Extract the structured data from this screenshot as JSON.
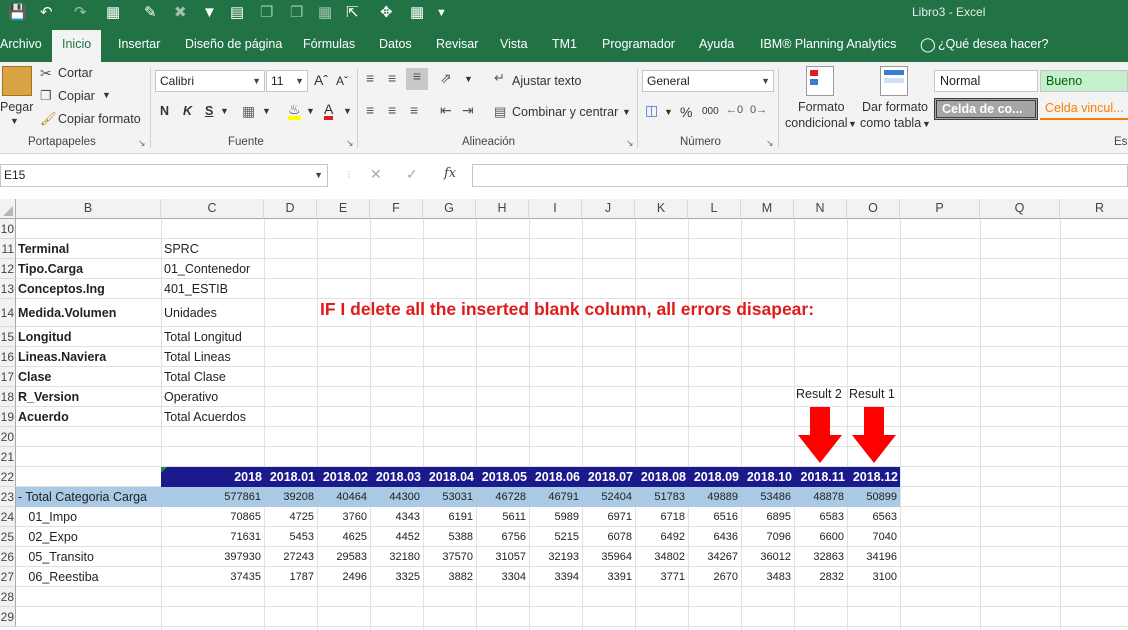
{
  "window": {
    "title": "Libro3  -  Excel"
  },
  "tabs": [
    "Archivo",
    "Inicio",
    "Insertar",
    "Diseño de página",
    "Fórmulas",
    "Datos",
    "Revisar",
    "Vista",
    "TM1",
    "Programador",
    "Ayuda",
    "IBM® Planning Analytics",
    "¿Qué desea hacer?"
  ],
  "ribbon": {
    "paste": "Pegar",
    "cut": "Cortar",
    "copy": "Copiar",
    "format_painter": "Copiar formato",
    "clipboard": "Portapapeles",
    "font_name": "Calibri",
    "font_size": "11",
    "bold": "N",
    "italic": "K",
    "underline": "S",
    "font": "Fuente",
    "wrap": "Ajustar texto",
    "merge": "Combinar y centrar",
    "alignment": "Alineación",
    "number_format": "General",
    "number": "Número",
    "percent": "%",
    "thousands": "000",
    "cond_format_1": "Formato",
    "cond_format_2": "condicional",
    "table_format_1": "Dar formato",
    "table_format_2": "como tabla",
    "style_normal": "Normal",
    "style_good": "Bueno",
    "style_check": "Celda de co...",
    "style_linked": "Celda vincul...",
    "styles": "Es"
  },
  "formula_bar": {
    "name_box": "E15",
    "fx": "fx",
    "formula": ""
  },
  "columns": [
    "B",
    "C",
    "D",
    "E",
    "F",
    "G",
    "H",
    "I",
    "J",
    "K",
    "L",
    "M",
    "N",
    "O",
    "P",
    "Q",
    "R"
  ],
  "rows": [
    "10",
    "11",
    "12",
    "13",
    "14",
    "15",
    "16",
    "17",
    "18",
    "19",
    "20",
    "21",
    "22",
    "23",
    "24",
    "25",
    "26",
    "27",
    "28",
    "29"
  ],
  "params": [
    {
      "label": "Terminal",
      "value": "SPRC"
    },
    {
      "label": "Tipo.Carga",
      "value": "01_Contenedor"
    },
    {
      "label": "Conceptos.Ing",
      "value": "401_ESTIB"
    },
    {
      "label": "Medida.Volumen",
      "value": "Unidades"
    },
    {
      "label": "Longitud",
      "value": "Total Longitud"
    },
    {
      "label": "Lineas.Naviera",
      "value": "Total Lineas"
    },
    {
      "label": "Clase",
      "value": "Total Clase"
    },
    {
      "label": "R_Version",
      "value": "Operativo"
    },
    {
      "label": "Acuerdo",
      "value": "Total Acuerdos"
    }
  ],
  "annotation": "IF I delete all the inserted blank column, all errors disapear:",
  "result_labels": [
    "Result 2",
    "Result 1"
  ],
  "table": {
    "headers": [
      "2018",
      "2018.01",
      "2018.02",
      "2018.03",
      "2018.04",
      "2018.05",
      "2018.06",
      "2018.07",
      "2018.08",
      "2018.09",
      "2018.10",
      "2018.11",
      "2018.12"
    ],
    "rows": [
      {
        "label": "- Total Categoria Carga",
        "values": [
          "577861",
          "39208",
          "40464",
          "44300",
          "53031",
          "46728",
          "46791",
          "52404",
          "51783",
          "49889",
          "53486",
          "48878",
          "50899"
        ]
      },
      {
        "label": "   01_Impo",
        "values": [
          "70865",
          "4725",
          "3760",
          "4343",
          "6191",
          "5611",
          "5989",
          "6971",
          "6718",
          "6516",
          "6895",
          "6583",
          "6563"
        ]
      },
      {
        "label": "   02_Expo",
        "values": [
          "71631",
          "5453",
          "4625",
          "4452",
          "5388",
          "6756",
          "5215",
          "6078",
          "6492",
          "6436",
          "7096",
          "6600",
          "7040"
        ]
      },
      {
        "label": "   05_Transito",
        "values": [
          "397930",
          "27243",
          "29583",
          "32180",
          "37570",
          "31057",
          "32193",
          "35964",
          "34802",
          "34267",
          "36012",
          "32863",
          "34196"
        ]
      },
      {
        "label": "   06_Reestiba",
        "values": [
          "37435",
          "1787",
          "2496",
          "3325",
          "3882",
          "3304",
          "3394",
          "3391",
          "3771",
          "2670",
          "3483",
          "2832",
          "3100"
        ]
      }
    ]
  },
  "colors": {
    "excel_green": "#217346",
    "header_fill": "#1a1a8c",
    "total_fill": "#a9c9e4",
    "annotation": "#e01b1b"
  }
}
